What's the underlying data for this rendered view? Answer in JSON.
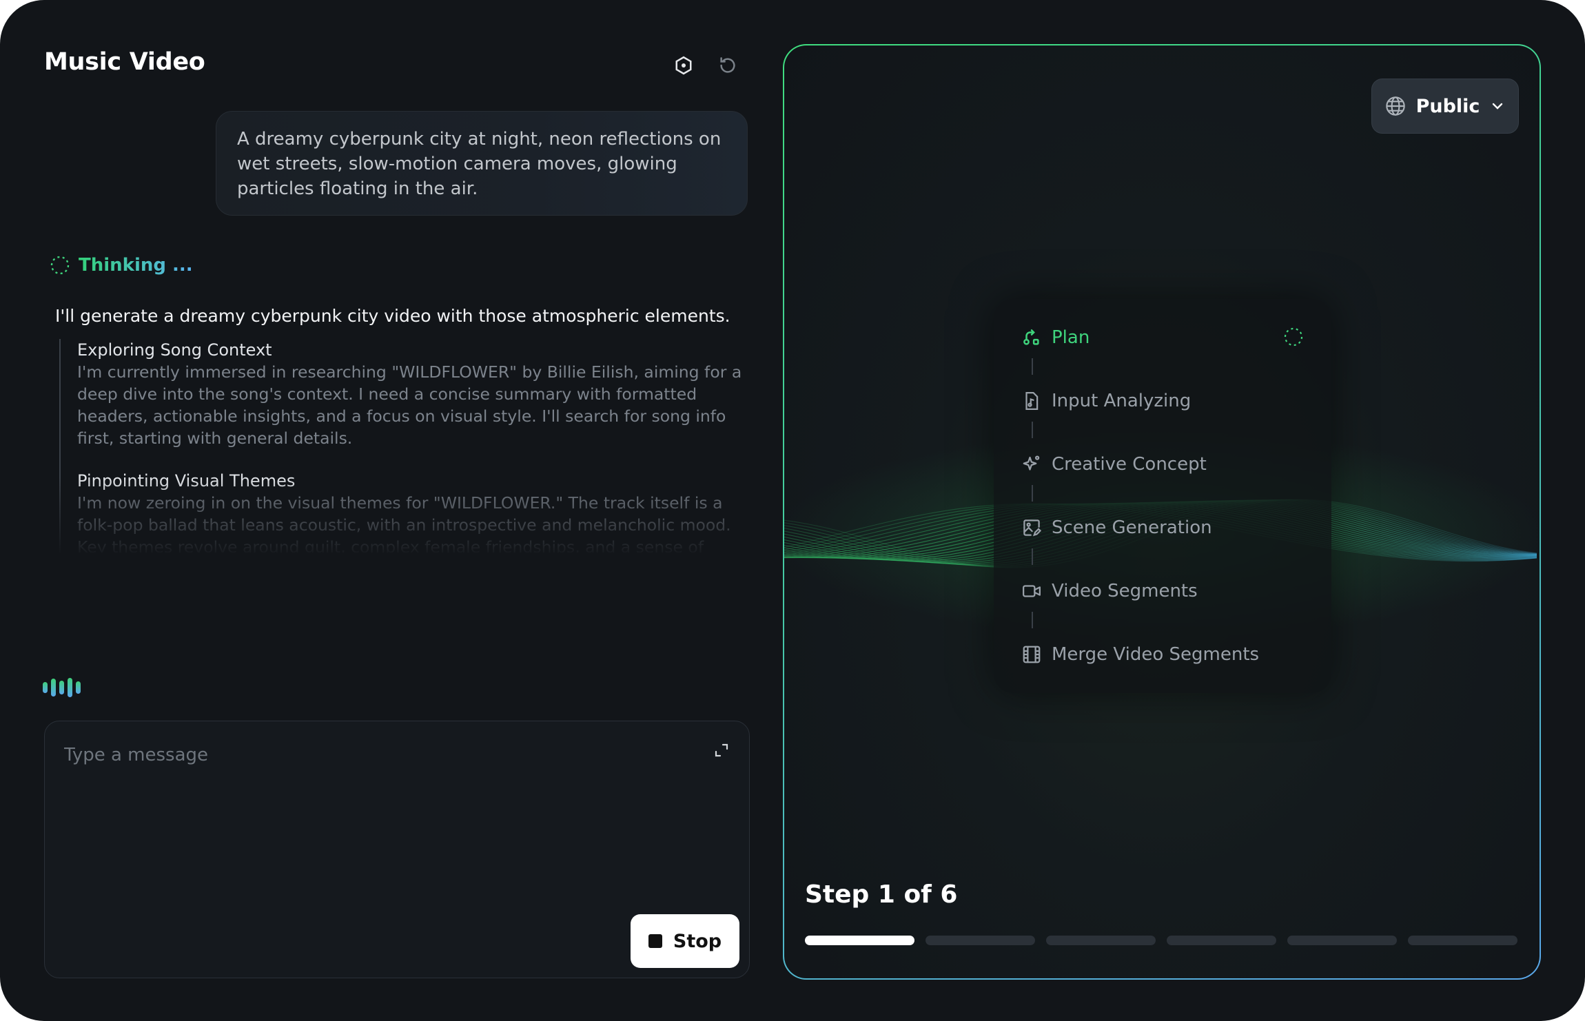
{
  "header": {
    "title": "Music Video",
    "settings_icon": "settings-icon",
    "refresh_icon": "refresh-icon"
  },
  "chat": {
    "user_prompt": "A dreamy cyberpunk city at night, neon reflections on wet streets, slow-motion camera moves, glowing particles floating in the air.",
    "thinking_label": "Thinking ...",
    "assistant_response": "I'll generate a dreamy cyberpunk city video with those atmospheric elements.",
    "reasoning": [
      {
        "title": "Exploring Song Context",
        "body": "I'm currently immersed in researching \"WILDFLOWER\" by Billie Eilish, aiming for a deep dive into the song's context. I need a concise summary with formatted headers, actionable insights, and a focus on visual style. I'll search for song info first, starting with general details."
      },
      {
        "title": "Pinpointing Visual Themes",
        "body": "I'm now zeroing in on the visual themes for \"WILDFLOWER.\" The track itself is a folk-pop ballad that leans acoustic, with an introspective and melancholic mood. Key themes revolve around guilt, complex female friendships, and a sense of betrayal."
      }
    ]
  },
  "composer": {
    "placeholder": "Type a message",
    "stop_label": "Stop"
  },
  "stage": {
    "visibility_label": "Public",
    "steps": [
      {
        "label": "Plan",
        "icon": "plan-icon",
        "state": "active"
      },
      {
        "label": "Input Analyzing",
        "icon": "music-file-icon",
        "state": "pending"
      },
      {
        "label": "Creative Concept",
        "icon": "sparkle-icon",
        "state": "pending"
      },
      {
        "label": "Scene Generation",
        "icon": "image-edit-icon",
        "state": "pending"
      },
      {
        "label": "Video Segments",
        "icon": "video-camera-icon",
        "state": "pending"
      },
      {
        "label": "Merge Video Segments",
        "icon": "film-icon",
        "state": "pending"
      }
    ],
    "step_counter": "Step 1 of 6",
    "progress": {
      "current": 1,
      "total": 6
    },
    "colors": {
      "accent": "#3fd47d",
      "accent_blue": "#5aa7ea"
    }
  }
}
